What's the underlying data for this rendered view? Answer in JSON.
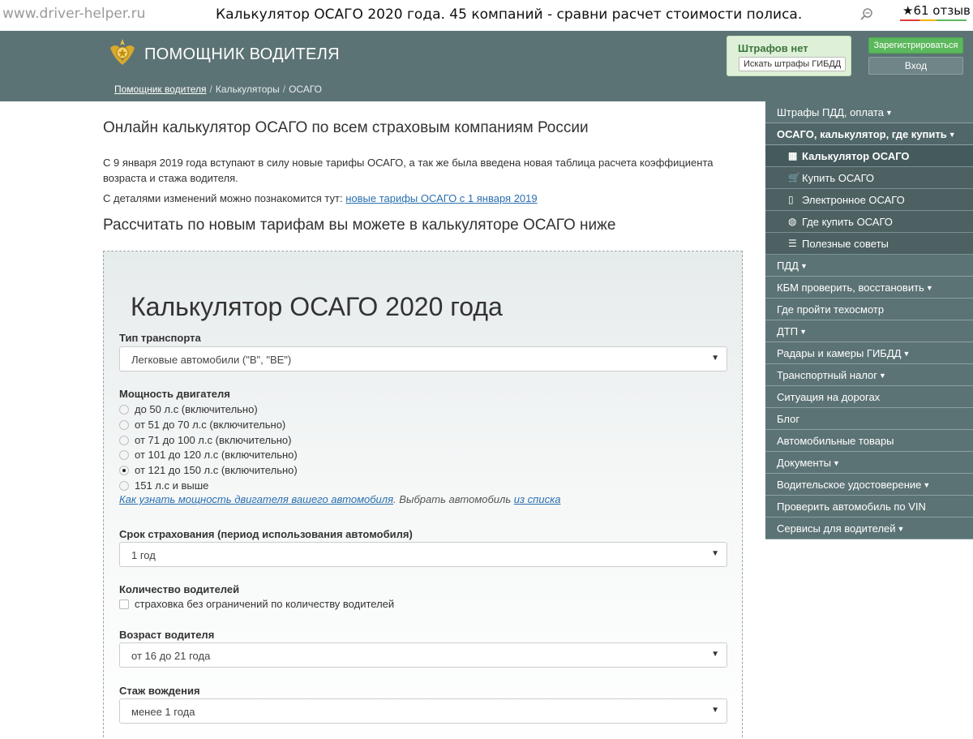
{
  "topbar": {
    "site_url": "www.driver-helper.ru",
    "page_title": "Калькулятор ОСАГО 2020 года. 45 компаний - сравни расчет стоимости полиса.",
    "reviews": "61 отзыв"
  },
  "header": {
    "brand": "ПОМОЩНИК ВОДИТЕЛЯ",
    "breadcrumb": [
      "Помощник водителя",
      "Калькуляторы",
      "ОСАГО"
    ],
    "fines_title": "Штрафов нет",
    "fines_button": "Искать штрафы ГИБДД",
    "register_button": "Зарегистрироваться",
    "login_button": "Вход"
  },
  "content": {
    "heading": "Онлайн калькулятор ОСАГО по всем страховым компаниям России",
    "intro": "С 9 января 2019 года вступают в силу новые тарифы ОСАГО, а так же была введена новая таблица расчета коэффициента возраста и стажа водителя.",
    "details_text": "С деталями изменений можно познакомится тут: ",
    "details_link": "новые тарифы ОСАГО с 1 января 2019",
    "subheading": "Рассчитать по новым тарифам вы можете в калькуляторе ОСАГО ниже"
  },
  "calculator": {
    "title": "Калькулятор ОСАГО 2020 года",
    "vehicle_type_label": "Тип транспорта",
    "vehicle_type_value": "Легковые автомобили (\"B\", \"BE\")",
    "engine_power_label": "Мощность двигателя",
    "engine_power_options": [
      "до 50 л.с (включительно)",
      "от 51 до 70 л.с (включительно)",
      "от 71 до 100 л.с (включительно)",
      "от 101 до 120 л.с (включительно)",
      "от 121 до 150 л.с (включительно)",
      "151 л.с и выше"
    ],
    "engine_power_selected_index": 4,
    "engine_help_link": "Как узнать мощность двигателя вашего автомобиля",
    "engine_help_text": ". Выбрать автомобиль ",
    "engine_help_link2": "из списка",
    "period_label": "Срок страхования (период использования автомобиля)",
    "period_value": "1 год",
    "drivers_label": "Количество водителей",
    "drivers_checkbox": "страховка без ограничений по количеству водителей",
    "drivers_checkbox_checked": false,
    "age_label": "Возраст водителя",
    "age_value": "от 16 до 21 года",
    "experience_label": "Стаж вождения",
    "experience_value": "менее 1 года"
  },
  "sidebar": {
    "items": [
      {
        "label": "Штрафы ПДД, оплата",
        "dropdown": true
      },
      {
        "label": "ОСАГО, калькулятор, где купить",
        "dropdown": true,
        "active": true
      },
      {
        "label": "ПДД",
        "dropdown": true
      },
      {
        "label": "КБМ проверить, восстановить",
        "dropdown": true
      },
      {
        "label": "Где пройти техосмотр",
        "dropdown": false
      },
      {
        "label": "ДТП",
        "dropdown": true
      },
      {
        "label": "Радары и камеры ГИБДД",
        "dropdown": true
      },
      {
        "label": "Транспортный налог",
        "dropdown": true
      },
      {
        "label": "Ситуация на дорогах",
        "dropdown": false
      },
      {
        "label": "Блог",
        "dropdown": false
      },
      {
        "label": "Автомобильные товары",
        "dropdown": false
      },
      {
        "label": "Документы",
        "dropdown": true
      },
      {
        "label": "Водительское удостоверение",
        "dropdown": true
      },
      {
        "label": "Проверить автомобиль по VIN",
        "dropdown": false
      },
      {
        "label": "Сервисы для водителей",
        "dropdown": true
      }
    ],
    "subitems": [
      {
        "label": "Калькулятор ОСАГО",
        "icon": "grid-icon",
        "current": true
      },
      {
        "label": "Купить ОСАГО",
        "icon": "cart-icon"
      },
      {
        "label": "Электронное ОСАГО",
        "icon": "phone-icon"
      },
      {
        "label": "Где купить ОСАГО",
        "icon": "globe-icon"
      },
      {
        "label": "Полезные советы",
        "icon": "list-icon"
      }
    ]
  }
}
